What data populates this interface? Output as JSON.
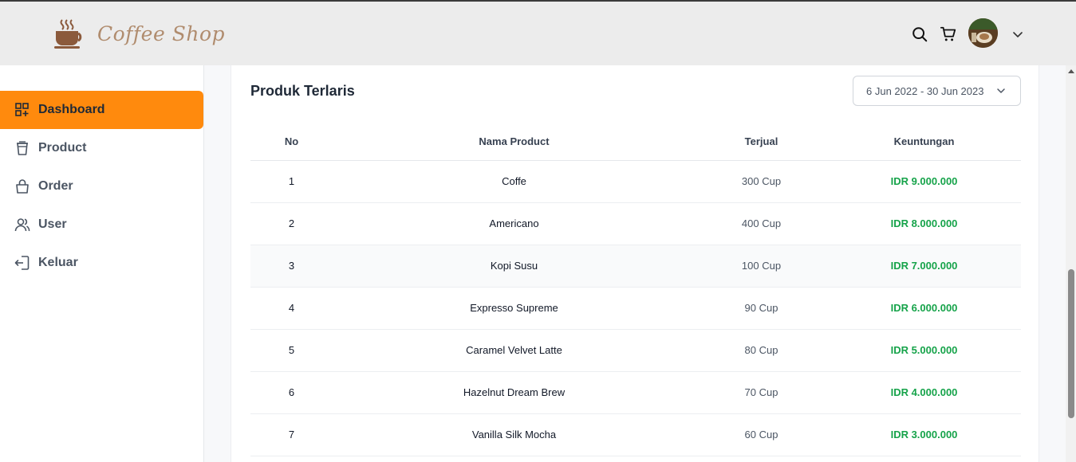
{
  "header": {
    "logo_text": "Coffee Shop",
    "icons": [
      "search-icon",
      "cart-icon",
      "chevron-down-icon"
    ]
  },
  "sidebar": {
    "items": [
      {
        "label": "Dashboard",
        "icon": "dashboard-icon",
        "active": true
      },
      {
        "label": "Product",
        "icon": "cup-icon",
        "active": false
      },
      {
        "label": "Order",
        "icon": "bag-icon",
        "active": false
      },
      {
        "label": "User",
        "icon": "users-icon",
        "active": false
      },
      {
        "label": "Keluar",
        "icon": "logout-icon",
        "active": false
      }
    ]
  },
  "main": {
    "title": "Produk Terlaris",
    "date_range": "6 Jun 2022 - 30 Jun 2023",
    "table": {
      "headers": [
        "No",
        "Nama Product",
        "Terjual",
        "Keuntungan"
      ],
      "rows": [
        [
          "1",
          "Coffe",
          "300 Cup",
          "IDR 9.000.000"
        ],
        [
          "2",
          "Americano",
          "400 Cup",
          "IDR 8.000.000"
        ],
        [
          "3",
          "Kopi Susu",
          "100 Cup",
          "IDR 7.000.000"
        ],
        [
          "4",
          "Expresso Supreme",
          "90 Cup",
          "IDR 6.000.000"
        ],
        [
          "5",
          "Caramel Velvet Latte",
          "80 Cup",
          "IDR 5.000.000"
        ],
        [
          "6",
          "Hazelnut Dream Brew",
          "70 Cup",
          "IDR 4.000.000"
        ],
        [
          "7",
          "Vanilla Silk Mocha",
          "60 Cup",
          "IDR 3.000.000"
        ]
      ]
    }
  },
  "colors": {
    "accent": "#ff8a0d",
    "profit": "#16a34a",
    "header_bg": "#ececec"
  }
}
